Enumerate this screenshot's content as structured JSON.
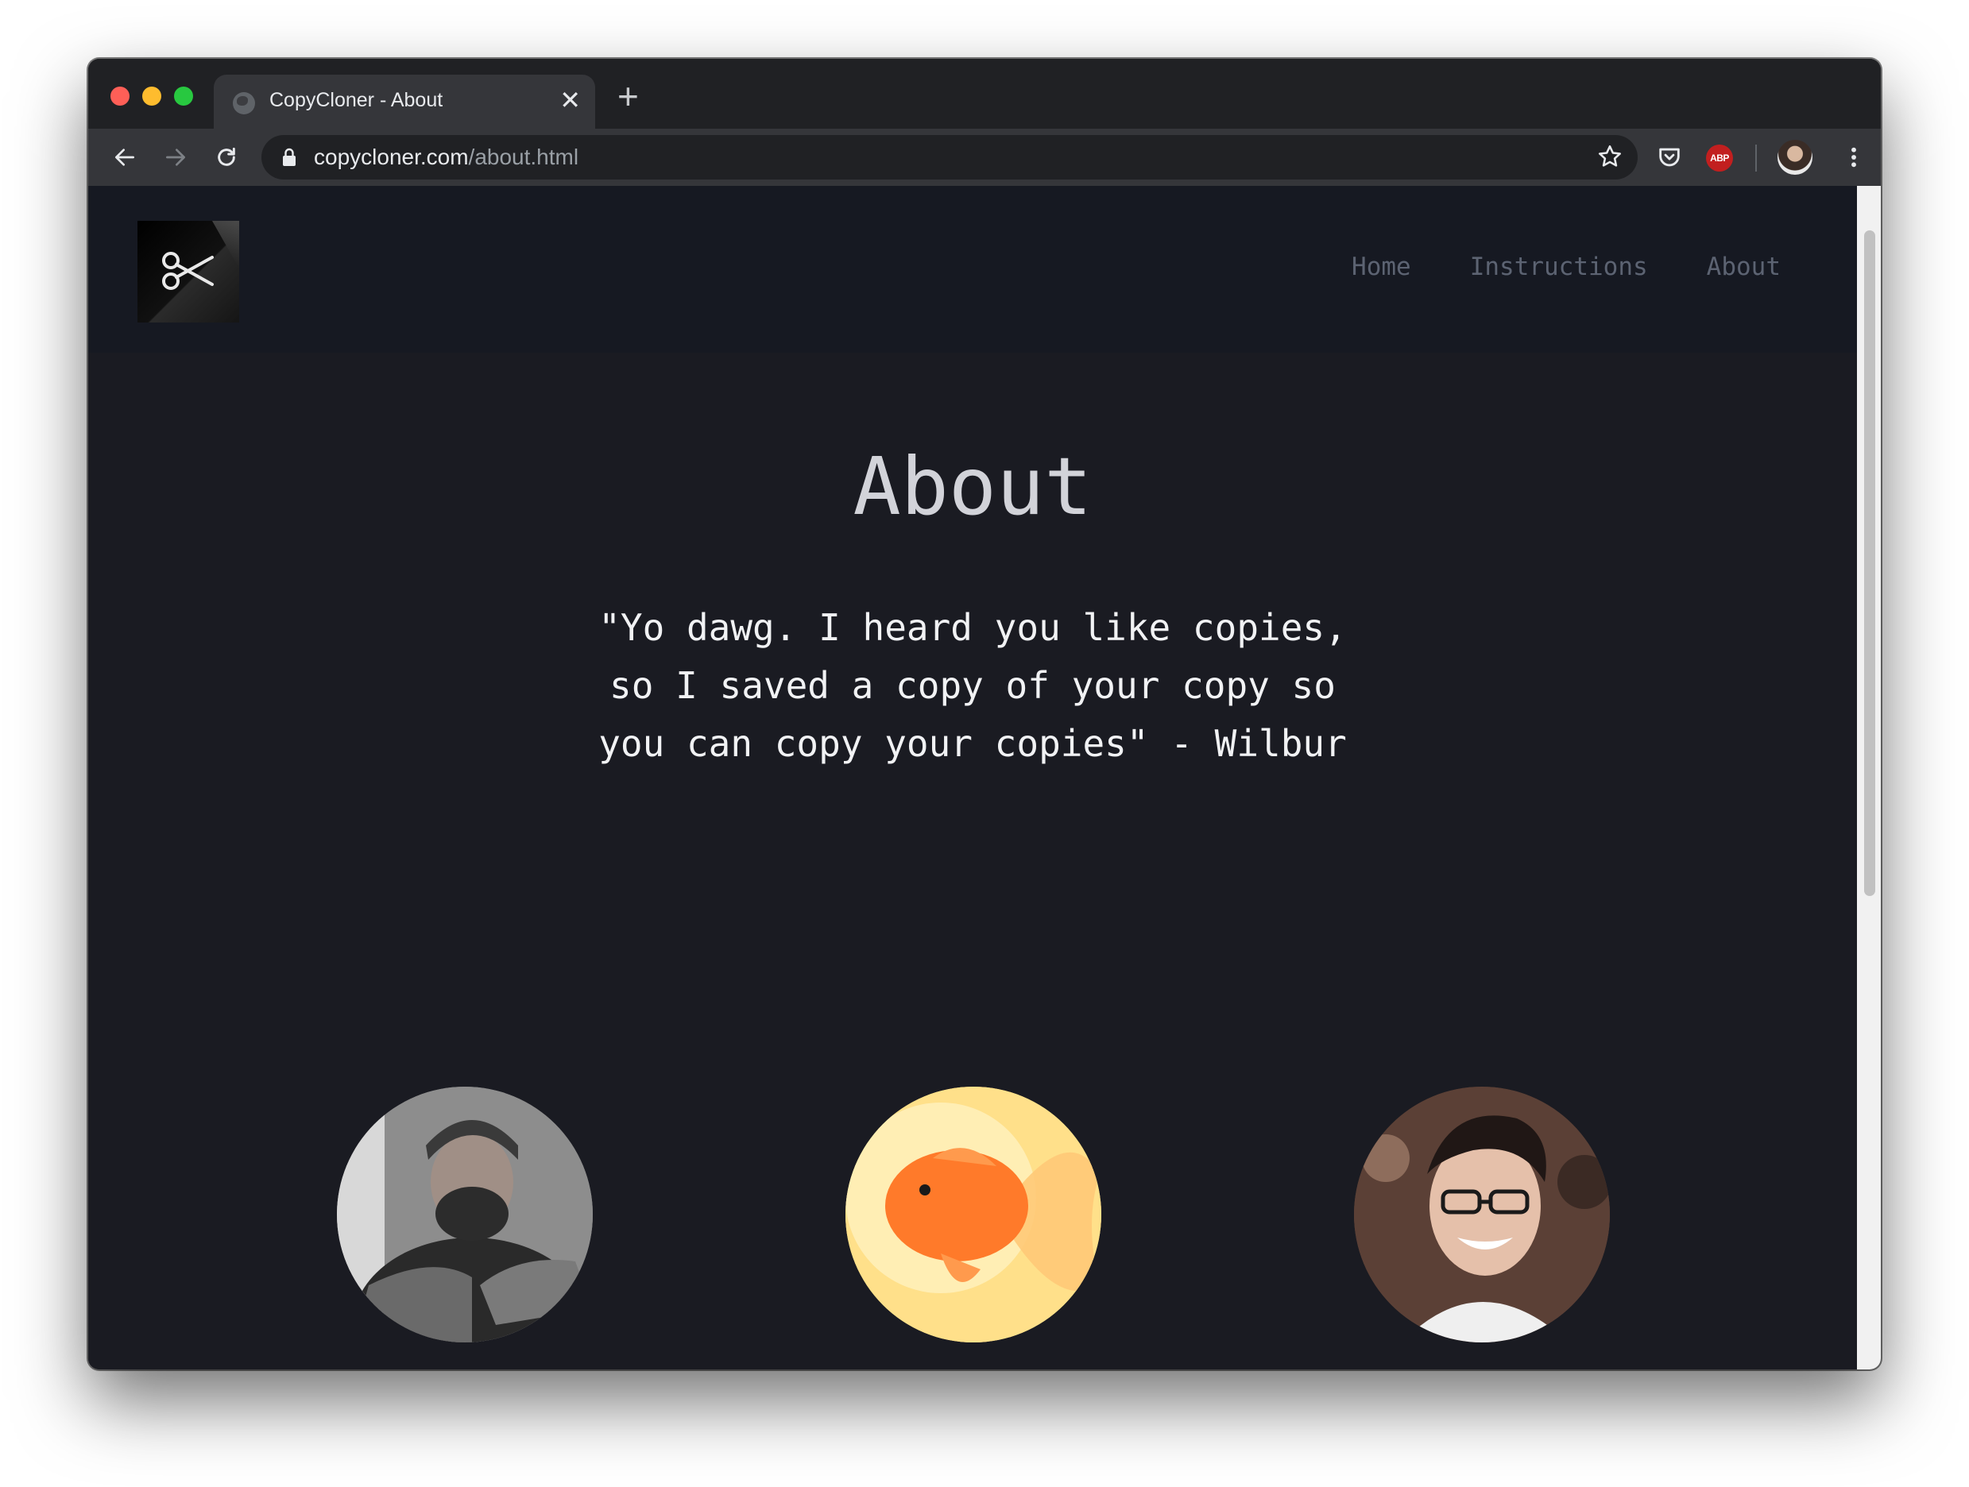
{
  "browser": {
    "tab_title": "CopyCloner - About",
    "url_host": "copycloner.com",
    "url_path": "/about.html",
    "extensions": {
      "abp_label": "ABP"
    },
    "colors": {
      "tabstrip": "#202124",
      "toolbar": "#35363a",
      "omnibox": "#202124"
    }
  },
  "site": {
    "nav": [
      {
        "label": "Home"
      },
      {
        "label": "Instructions"
      },
      {
        "label": "About"
      }
    ],
    "title": "About",
    "quote_lines": [
      "\"Yo dawg. I heard you like copies,",
      "so I saved a copy of your copy so",
      "you can copy your copies\" - Wilbur"
    ],
    "colors": {
      "background": "#1a1b22",
      "header": "#161922",
      "nav_text": "#5c6372",
      "title": "#d2d3d9",
      "quote": "#f1f2f4"
    },
    "team_icons": [
      "person-photo-bw",
      "goldfish-photo",
      "person-photo-glasses"
    ]
  }
}
